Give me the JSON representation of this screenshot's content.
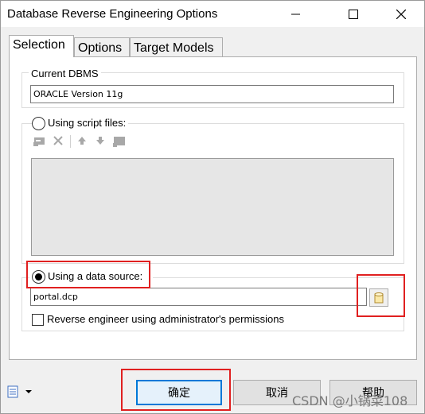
{
  "window": {
    "title": "Database Reverse Engineering Options"
  },
  "tabs": [
    {
      "label": "Selection",
      "active": true
    },
    {
      "label": "Options",
      "active": false
    },
    {
      "label": "Target Models",
      "active": false
    }
  ],
  "current_dbms": {
    "label": "Current DBMS",
    "value": "ORACLE Version 11g"
  },
  "script_files": {
    "label": "Using script files:",
    "selected": false,
    "toolbar_icons": [
      "add-file-icon",
      "delete-icon",
      "move-up-icon",
      "move-down-icon",
      "folder-icon"
    ]
  },
  "data_source": {
    "label": "Using a data source:",
    "selected": true,
    "value": "portal.dcp",
    "browse_icon": "database-icon"
  },
  "admin_permissions": {
    "label": "Reverse engineer using administrator's permissions",
    "checked": false
  },
  "buttons": {
    "ok": "确定",
    "cancel": "取消",
    "help": "帮助"
  },
  "watermark": "CSDN @小锅菜108",
  "colors": {
    "highlight_red": "#e02020",
    "default_button_border": "#0078d7"
  }
}
